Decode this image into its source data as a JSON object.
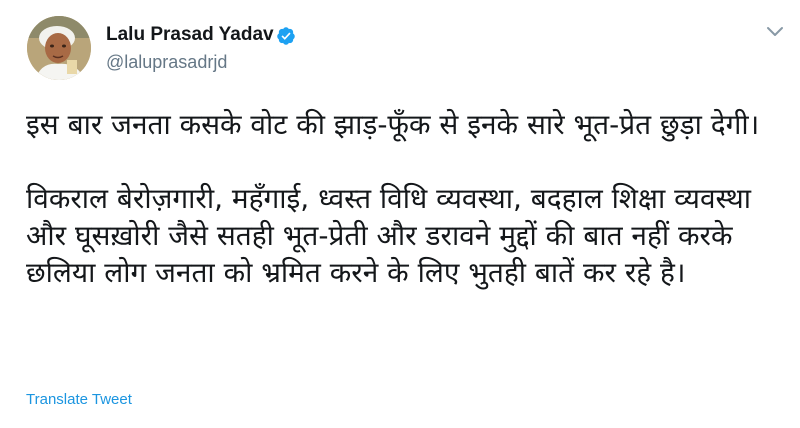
{
  "tweet": {
    "author_name": "Lalu Prasad Yadav",
    "handle": "@laluprasadrjd",
    "verified": true,
    "avatar_icon": "profile-photo",
    "menu_icon": "chevron-down-icon",
    "paragraphs": [
      "इस बार जनता कसके वोट की झाड़-फूँक से इनके सारे भूत-प्रेत छुड़ा देगी।",
      "विकराल बेरोज़गारी, महँगाई, ध्वस्त विधि व्यवस्था, बदहाल शिक्षा व्यवस्था और घूसख़ोरी जैसे सतही भूत-प्रेती और डरावने मुद्दों की बात नहीं करके छलिया लोग जनता को भ्रमित करने के लिए भुतही बातें कर रहे है।"
    ],
    "translate_label": "Translate Tweet",
    "colors": {
      "link": "#1b95e0",
      "verified_badge": "#1da1f2",
      "secondary_text": "#657786",
      "primary_text": "#14171a"
    }
  }
}
